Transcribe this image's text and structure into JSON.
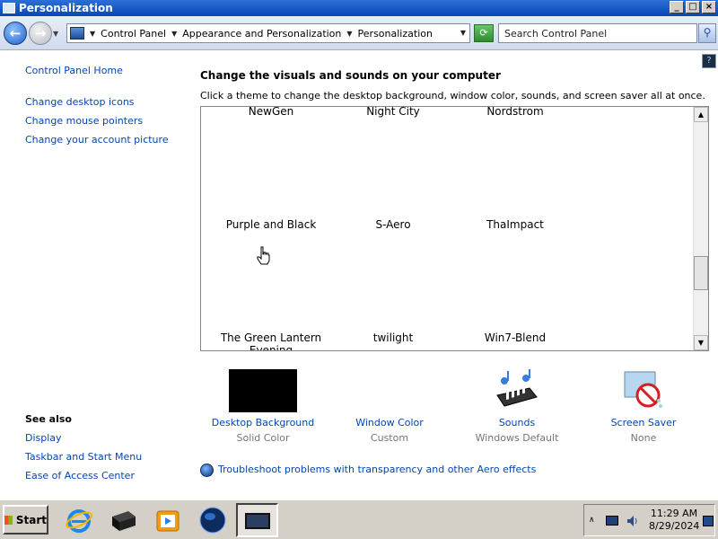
{
  "window": {
    "title": "Personalization"
  },
  "nav": {
    "breadcrumb": [
      "Control Panel",
      "Appearance and Personalization",
      "Personalization"
    ],
    "search_placeholder": "Search Control Panel"
  },
  "left": {
    "home": "Control Panel Home",
    "links": [
      "Change desktop icons",
      "Change mouse pointers",
      "Change your account picture"
    ],
    "see_also_title": "See also",
    "see_also": [
      "Display",
      "Taskbar and Start Menu",
      "Ease of Access Center"
    ]
  },
  "main": {
    "heading": "Change the visuals and sounds on your computer",
    "subtext": "Click a theme to change the desktop background, window color, sounds, and screen saver all at once.",
    "themes": [
      "NewGen",
      "Night City",
      "Nordstrom",
      "Purple and Black",
      "S-Aero",
      "ThaImpact",
      "The Green Lantern Evening",
      "twilight",
      "Win7-Blend"
    ],
    "settings": [
      {
        "label": "Desktop Background",
        "value": "Solid Color"
      },
      {
        "label": "Window Color",
        "value": "Custom"
      },
      {
        "label": "Sounds",
        "value": "Windows Default"
      },
      {
        "label": "Screen Saver",
        "value": "None"
      }
    ],
    "trouble_link": "Troubleshoot problems with transparency and other Aero effects"
  },
  "taskbar": {
    "start": "Start",
    "time": "11:29 AM",
    "date": "8/29/2024",
    "icons": [
      "internet-explorer-icon",
      "storage-icon",
      "media-player-icon",
      "globe-icon",
      "personalization-icon"
    ]
  }
}
